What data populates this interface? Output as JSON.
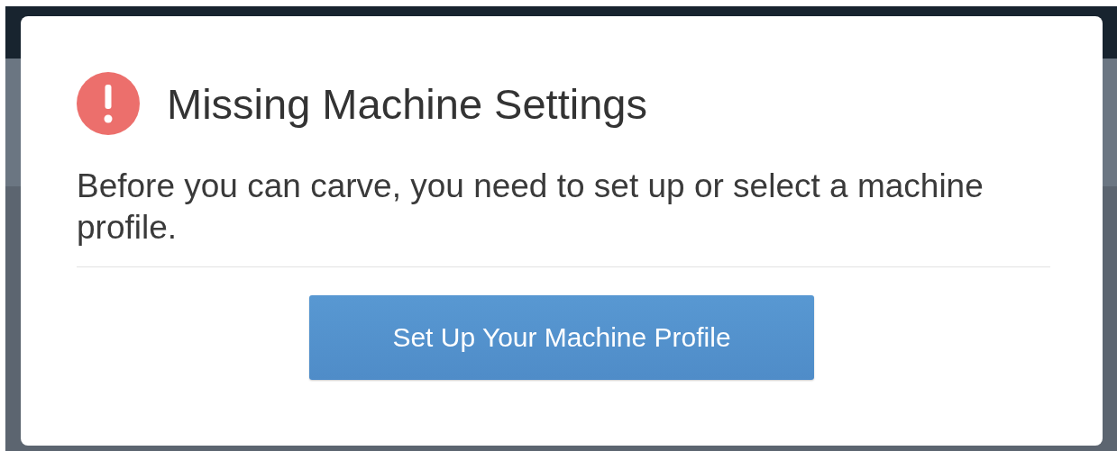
{
  "dialog": {
    "title": "Missing Machine Settings",
    "message": "Before you can carve, you need to set up or select a machine profile.",
    "button": "Set Up Your Machine Profile"
  }
}
